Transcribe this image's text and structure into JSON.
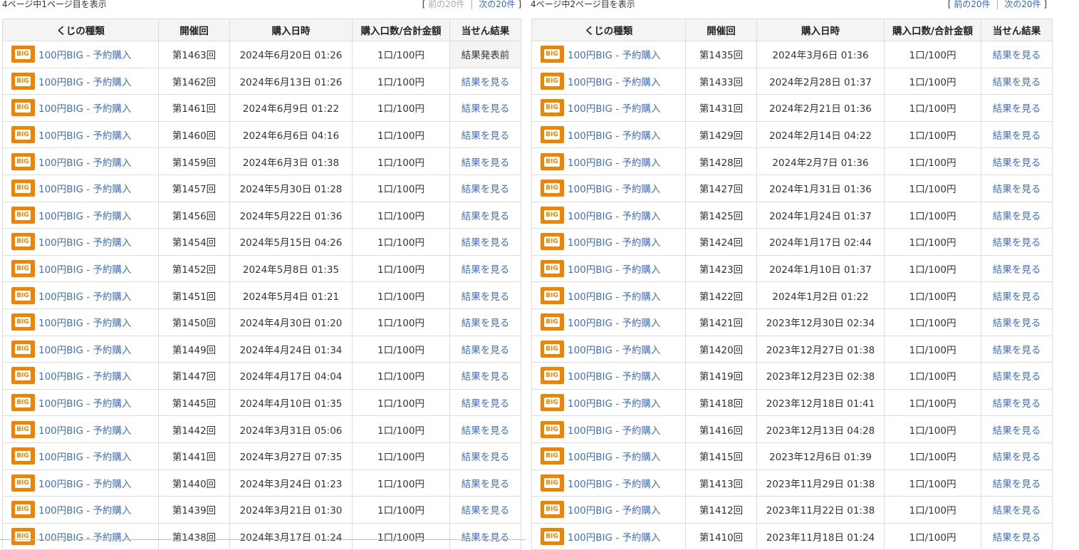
{
  "left": {
    "page_info": "4ページ中1ページ目を表示",
    "nav": {
      "open": "[",
      "prev": "前の20件",
      "sep": "|",
      "next": "次の20件",
      "close": "]"
    },
    "headers": {
      "kind": "くじの種類",
      "round": "開催回",
      "date": "購入日時",
      "qty": "購入口数/合計金額",
      "result": "当せん結果"
    },
    "rows": [
      {
        "logo": "BIG",
        "kind": "100円BIG - 予約購入",
        "round": "第1463回",
        "date": "2024年6月20日 01:26",
        "qty": "1口/100円",
        "result": "結果発表前"
      },
      {
        "logo": "BIG",
        "kind": "100円BIG - 予約購入",
        "round": "第1462回",
        "date": "2024年6月13日 01:26",
        "qty": "1口/100円",
        "result": "結果を見る"
      },
      {
        "logo": "BIG",
        "kind": "100円BIG - 予約購入",
        "round": "第1461回",
        "date": "2024年6月9日 01:22",
        "qty": "1口/100円",
        "result": "結果を見る"
      },
      {
        "logo": "BIG",
        "kind": "100円BIG - 予約購入",
        "round": "第1460回",
        "date": "2024年6月6日 04:16",
        "qty": "1口/100円",
        "result": "結果を見る"
      },
      {
        "logo": "BIG",
        "kind": "100円BIG - 予約購入",
        "round": "第1459回",
        "date": "2024年6月3日 01:38",
        "qty": "1口/100円",
        "result": "結果を見る"
      },
      {
        "logo": "BIG",
        "kind": "100円BIG - 予約購入",
        "round": "第1457回",
        "date": "2024年5月30日 01:28",
        "qty": "1口/100円",
        "result": "結果を見る"
      },
      {
        "logo": "BIG",
        "kind": "100円BIG - 予約購入",
        "round": "第1456回",
        "date": "2024年5月22日 01:36",
        "qty": "1口/100円",
        "result": "結果を見る"
      },
      {
        "logo": "BIG",
        "kind": "100円BIG - 予約購入",
        "round": "第1454回",
        "date": "2024年5月15日 04:26",
        "qty": "1口/100円",
        "result": "結果を見る"
      },
      {
        "logo": "BIG",
        "kind": "100円BIG - 予約購入",
        "round": "第1452回",
        "date": "2024年5月8日 01:35",
        "qty": "1口/100円",
        "result": "結果を見る"
      },
      {
        "logo": "BIG",
        "kind": "100円BIG - 予約購入",
        "round": "第1451回",
        "date": "2024年5月4日 01:21",
        "qty": "1口/100円",
        "result": "結果を見る"
      },
      {
        "logo": "BIG",
        "kind": "100円BIG - 予約購入",
        "round": "第1450回",
        "date": "2024年4月30日 01:20",
        "qty": "1口/100円",
        "result": "結果を見る"
      },
      {
        "logo": "BIG",
        "kind": "100円BIG - 予約購入",
        "round": "第1449回",
        "date": "2024年4月24日 01:34",
        "qty": "1口/100円",
        "result": "結果を見る"
      },
      {
        "logo": "BIG",
        "kind": "100円BIG - 予約購入",
        "round": "第1447回",
        "date": "2024年4月17日 04:04",
        "qty": "1口/100円",
        "result": "結果を見る"
      },
      {
        "logo": "BIG",
        "kind": "100円BIG - 予約購入",
        "round": "第1445回",
        "date": "2024年4月10日 01:35",
        "qty": "1口/100円",
        "result": "結果を見る"
      },
      {
        "logo": "BIG",
        "kind": "100円BIG - 予約購入",
        "round": "第1442回",
        "date": "2024年3月31日 05:06",
        "qty": "1口/100円",
        "result": "結果を見る"
      },
      {
        "logo": "BIG",
        "kind": "100円BIG - 予約購入",
        "round": "第1441回",
        "date": "2024年3月27日 07:35",
        "qty": "1口/100円",
        "result": "結果を見る"
      },
      {
        "logo": "BIG",
        "kind": "100円BIG - 予約購入",
        "round": "第1440回",
        "date": "2024年3月24日 01:23",
        "qty": "1口/100円",
        "result": "結果を見る"
      },
      {
        "logo": "BIG",
        "kind": "100円BIG - 予約購入",
        "round": "第1439回",
        "date": "2024年3月21日 01:30",
        "qty": "1口/100円",
        "result": "結果を見る"
      },
      {
        "logo": "BIG",
        "kind": "100円BIG - 予約購入",
        "round": "第1438回",
        "date": "2024年3月17日 01:24",
        "qty": "1口/100円",
        "result": "結果を見る"
      }
    ]
  },
  "right": {
    "page_info": "4ページ中2ページ目を表示",
    "nav": {
      "open": "[",
      "prev": "前の20件",
      "sep": "|",
      "next": "次の20件",
      "close": "]"
    },
    "headers": {
      "kind": "くじの種類",
      "round": "開催回",
      "date": "購入日時",
      "qty": "購入口数/合計金額",
      "result": "当せん結果"
    },
    "rows": [
      {
        "logo": "BIG",
        "kind": "100円BIG - 予約購入",
        "round": "第1435回",
        "date": "2024年3月6日 01:36",
        "qty": "1口/100円",
        "result": "結果を見る"
      },
      {
        "logo": "BIG",
        "kind": "100円BIG - 予約購入",
        "round": "第1433回",
        "date": "2024年2月28日 01:37",
        "qty": "1口/100円",
        "result": "結果を見る"
      },
      {
        "logo": "BIG",
        "kind": "100円BIG - 予約購入",
        "round": "第1431回",
        "date": "2024年2月21日 01:36",
        "qty": "1口/100円",
        "result": "結果を見る"
      },
      {
        "logo": "BIG",
        "kind": "100円BIG - 予約購入",
        "round": "第1429回",
        "date": "2024年2月14日 04:22",
        "qty": "1口/100円",
        "result": "結果を見る"
      },
      {
        "logo": "BIG",
        "kind": "100円BIG - 予約購入",
        "round": "第1428回",
        "date": "2024年2月7日 01:36",
        "qty": "1口/100円",
        "result": "結果を見る"
      },
      {
        "logo": "BIG",
        "kind": "100円BIG - 予約購入",
        "round": "第1427回",
        "date": "2024年1月31日 01:36",
        "qty": "1口/100円",
        "result": "結果を見る"
      },
      {
        "logo": "BIG",
        "kind": "100円BIG - 予約購入",
        "round": "第1425回",
        "date": "2024年1月24日 01:37",
        "qty": "1口/100円",
        "result": "結果を見る"
      },
      {
        "logo": "BIG",
        "kind": "100円BIG - 予約購入",
        "round": "第1424回",
        "date": "2024年1月17日 02:44",
        "qty": "1口/100円",
        "result": "結果を見る"
      },
      {
        "logo": "BIG",
        "kind": "100円BIG - 予約購入",
        "round": "第1423回",
        "date": "2024年1月10日 01:37",
        "qty": "1口/100円",
        "result": "結果を見る"
      },
      {
        "logo": "BIG",
        "kind": "100円BIG - 予約購入",
        "round": "第1422回",
        "date": "2024年1月2日 01:22",
        "qty": "1口/100円",
        "result": "結果を見る"
      },
      {
        "logo": "BIG",
        "kind": "100円BIG - 予約購入",
        "round": "第1421回",
        "date": "2023年12月30日 02:34",
        "qty": "1口/100円",
        "result": "結果を見る"
      },
      {
        "logo": "BIG",
        "kind": "100円BIG - 予約購入",
        "round": "第1420回",
        "date": "2023年12月27日 01:38",
        "qty": "1口/100円",
        "result": "結果を見る"
      },
      {
        "logo": "BIG",
        "kind": "100円BIG - 予約購入",
        "round": "第1419回",
        "date": "2023年12月23日 02:38",
        "qty": "1口/100円",
        "result": "結果を見る"
      },
      {
        "logo": "BIG",
        "kind": "100円BIG - 予約購入",
        "round": "第1418回",
        "date": "2023年12月18日 01:41",
        "qty": "1口/100円",
        "result": "結果を見る"
      },
      {
        "logo": "BIG",
        "kind": "100円BIG - 予約購入",
        "round": "第1416回",
        "date": "2023年12月13日 04:28",
        "qty": "1口/100円",
        "result": "結果を見る"
      },
      {
        "logo": "BIG",
        "kind": "100円BIG - 予約購入",
        "round": "第1415回",
        "date": "2023年12月6日 01:39",
        "qty": "1口/100円",
        "result": "結果を見る"
      },
      {
        "logo": "BIG",
        "kind": "100円BIG - 予約購入",
        "round": "第1413回",
        "date": "2023年11月29日 01:38",
        "qty": "1口/100円",
        "result": "結果を見る"
      },
      {
        "logo": "BIG",
        "kind": "100円BIG - 予約購入",
        "round": "第1412回",
        "date": "2023年11月22日 01:38",
        "qty": "1口/100円",
        "result": "結果を見る"
      },
      {
        "logo": "BIG",
        "kind": "100円BIG - 予約購入",
        "round": "第1410回",
        "date": "2023年11月18日 01:24",
        "qty": "1口/100円",
        "result": "結果を見る"
      }
    ]
  }
}
